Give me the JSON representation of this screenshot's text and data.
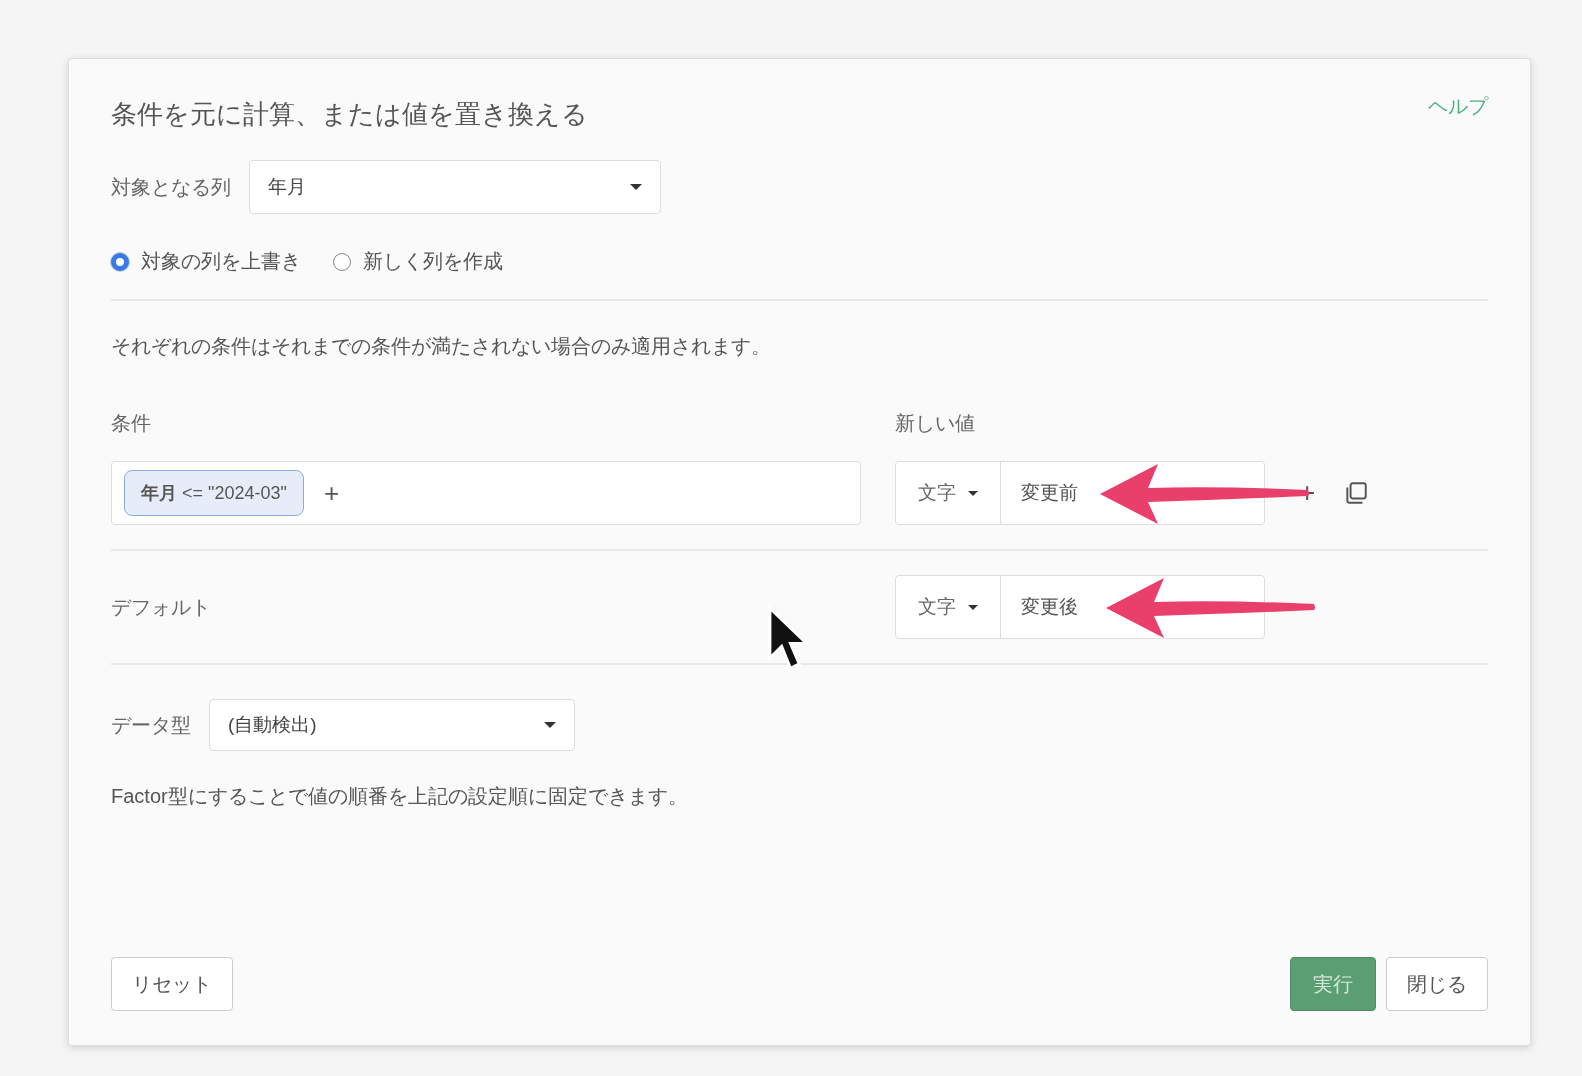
{
  "dialog": {
    "title": "条件を元に計算、または値を置き換える",
    "help_link": "ヘルプ"
  },
  "target_column": {
    "label": "対象となる列",
    "value": "年月"
  },
  "mode_options": [
    {
      "label": "対象の列を上書き",
      "selected": true
    },
    {
      "label": "新しく列を作成",
      "selected": false
    }
  ],
  "note": "それぞれの条件はそれまでの条件が満たされない場合のみ適用されます。",
  "conditions_header": "条件",
  "new_value_header": "新しい値",
  "conditions": [
    {
      "chip": "**年月** <= \"2024-03\"",
      "add": "+",
      "type": "文字",
      "value": "変更前",
      "annotated": true,
      "add_row": "+"
    }
  ],
  "default": {
    "label": "デフォルト",
    "type": "文字",
    "value": "変更後",
    "annotated": true
  },
  "data_type": {
    "label": "データ型",
    "value": "(自動検出)"
  },
  "factor_note": "Factor型にすることで値の順番を上記の設定順に固定できます。",
  "buttons": {
    "reset": "リセット",
    "run": "実行",
    "close": "閉じる"
  }
}
